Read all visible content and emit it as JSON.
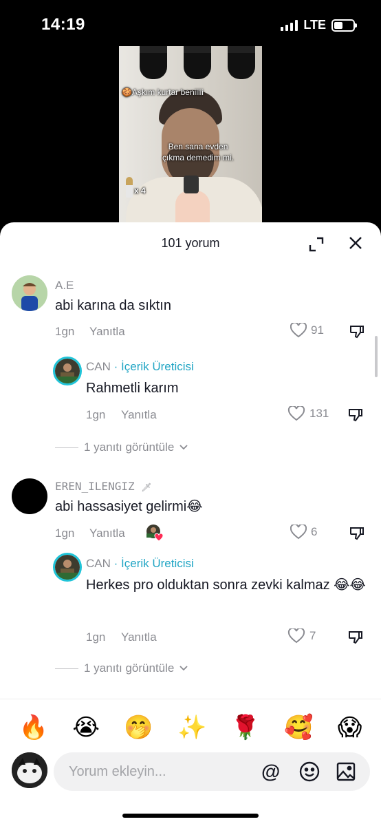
{
  "status_bar": {
    "time": "14:19",
    "network": "LTE"
  },
  "video": {
    "caption_top": "🍪Aşkım kurtar beniiiii",
    "caption_mid": "Ben sana evden çıkma demedim mi.",
    "ammo": "x 4"
  },
  "sheet": {
    "title": "101 yorum"
  },
  "comments": [
    {
      "username": "A.E",
      "text": "abi karına da sıktın",
      "time": "1gn",
      "reply_label": "Yanıtla",
      "likes": "91",
      "replies": [
        {
          "username": "CAN",
          "creator_label": " · İçerik Üreticisi",
          "text": "Rahmetli karım",
          "time": "1gn",
          "reply_label": "Yanıtla",
          "likes": "131"
        }
      ],
      "view_replies": "1 yanıtı görüntüle"
    },
    {
      "username": "EREN_ILENGIZ",
      "username_suffix": "🗡",
      "text": "abi hassasiyet gelirmi😂",
      "time": "1gn",
      "reply_label": "Yanıtla",
      "likes": "6",
      "replies": [
        {
          "username": "CAN",
          "creator_label": " · İçerik Üreticisi",
          "text": "Herkes pro olduktan sonra zevki kalmaz 😂😂",
          "time": "1gn",
          "reply_label": "Yanıtla",
          "likes": "7"
        }
      ],
      "view_replies": "1 yanıtı görüntüle"
    }
  ],
  "emoji_bar": [
    "🔥",
    "😭",
    "🤭",
    "✨",
    "🌹",
    "🥰",
    "😱"
  ],
  "input": {
    "placeholder": "Yorum ekleyin...",
    "at_symbol": "@"
  },
  "colors": {
    "creator_accent": "#20a5c4",
    "text": "#161823",
    "muted": "#8a8b91",
    "liked_heart": "#fe2c55"
  }
}
